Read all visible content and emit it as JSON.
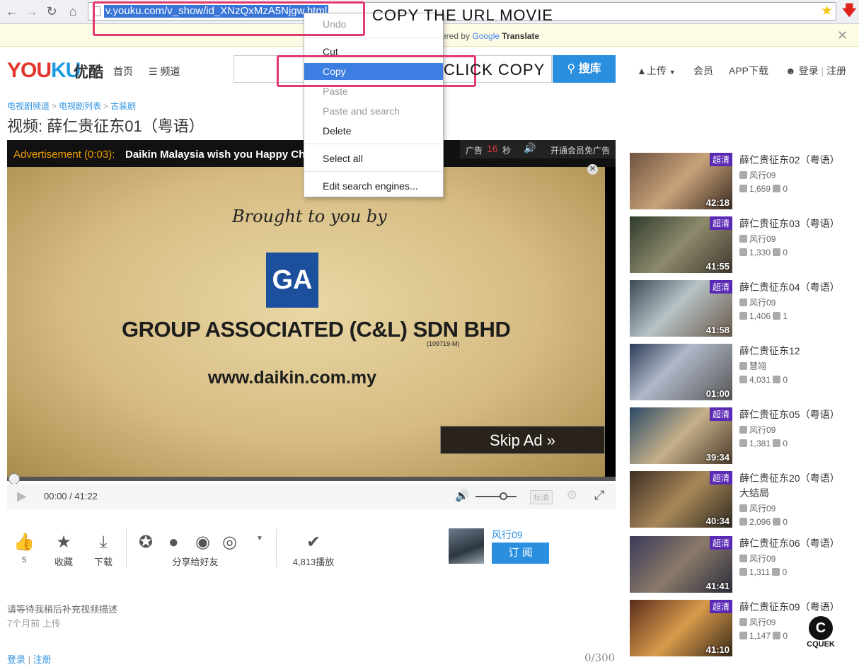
{
  "browser": {
    "url": "v.youku.com/v_show/id_XNzQxMzA5Njgw.html",
    "translate_text": "ered by",
    "translate_google": "Google",
    "translate_brand": "Translate"
  },
  "context_menu": {
    "items": [
      "Undo",
      "Cut",
      "Copy",
      "Paste",
      "Paste and search",
      "Delete",
      "Select all",
      "Edit search engines..."
    ],
    "selected": "Copy"
  },
  "annotations": {
    "copy_url": "COPY THE URL MOVIE",
    "click_copy": "CLICK COPY"
  },
  "header": {
    "logo_you": "YOU",
    "logo_ku": "KU",
    "logo_cn": "优酷",
    "nav_home": "首页",
    "nav_channels": "频道",
    "search_button": "搜库",
    "upload": "上传",
    "member": "会员",
    "app_download": "APP下载",
    "login": "登录",
    "register": "注册"
  },
  "breadcrumb": [
    "电视剧频道",
    "电视剧列表",
    "古装剧"
  ],
  "video_title": "视频: 薛仁贵征东01（粤语）",
  "player": {
    "ad_label": "Advertisement (0:03):",
    "ad_text": "Daikin Malaysia wish you Happy Chi",
    "ad_countdown_label": "广告",
    "ad_countdown_value": "16",
    "ad_countdown_unit": "秒",
    "vip_no_ads": "开通会员免广告",
    "brought_by": "Brought to you by",
    "ad_logo": "GA",
    "company": "GROUP ASSOCIATED (C&L) SDN BHD",
    "company_regno": "(109719-M)",
    "website": "www.daikin.com.my",
    "skip_ad": "Skip Ad »",
    "time": "00:00 / 41:22",
    "quality": "标清"
  },
  "actions": {
    "like_count": "5",
    "favorite": "收藏",
    "download": "下载",
    "share": "分享给好友",
    "plays": "4,813播放",
    "uploader": "风行09",
    "subscribe": "订 阅"
  },
  "description": {
    "text": "请等待我稍后补充视频描述",
    "posted": "7个月前 上传",
    "login": "登录",
    "register": "注册",
    "char_counter": "0/300"
  },
  "related": [
    {
      "title": "薛仁贵征东02（粤语）",
      "uploader": "风行09",
      "views": "1,659",
      "comments": "0",
      "duration": "42:18",
      "badge": "超清"
    },
    {
      "title": "薛仁贵征东03（粤语）",
      "uploader": "风行09",
      "views": "1,330",
      "comments": "0",
      "duration": "41:55",
      "badge": "超清"
    },
    {
      "title": "薛仁贵征东04（粤语）",
      "uploader": "风行09",
      "views": "1,406",
      "comments": "1",
      "duration": "41:58",
      "badge": "超清"
    },
    {
      "title": "薛仁贵征东12",
      "uploader": "慧翊",
      "views": "4,031",
      "comments": "0",
      "duration": "01:00",
      "badge": ""
    },
    {
      "title": "薛仁贵征东05（粤语）",
      "uploader": "风行09",
      "views": "1,381",
      "comments": "0",
      "duration": "39:34",
      "badge": "超清"
    },
    {
      "title": "薛仁贵征东20（粤语）",
      "title2": "大结局",
      "uploader": "风行09",
      "views": "2,096",
      "comments": "0",
      "duration": "40:34",
      "badge": "超清"
    },
    {
      "title": "薛仁贵征东06（粤语）",
      "uploader": "风行09",
      "views": "1,311",
      "comments": "0",
      "duration": "41:41",
      "badge": "超清"
    },
    {
      "title": "薛仁贵征东09（粤语）",
      "uploader": "风行09",
      "views": "1,147",
      "comments": "0",
      "duration": "41:10",
      "badge": "超清"
    }
  ],
  "watermark": "CQUEK"
}
